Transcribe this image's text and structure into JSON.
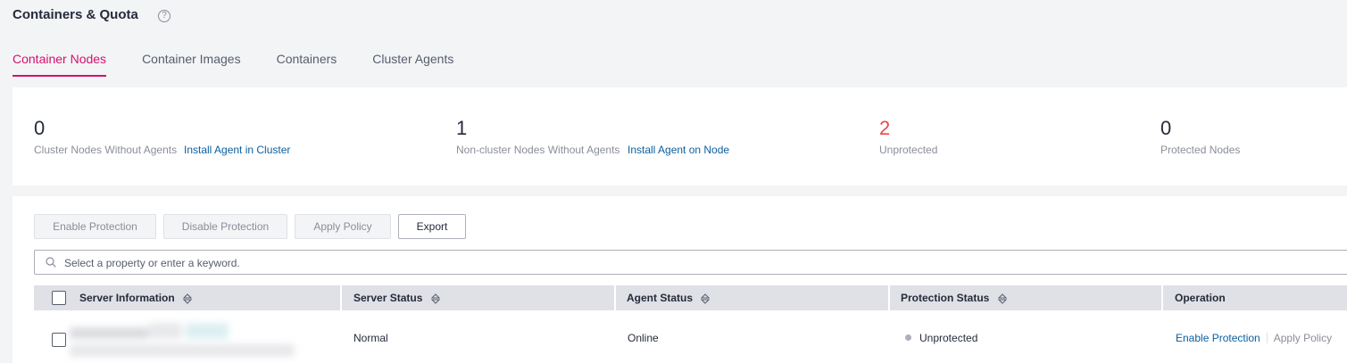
{
  "page": {
    "title": "Containers & Quota",
    "help_icon": "help-icon",
    "help_glyph": "?"
  },
  "tabs": [
    {
      "label": "Container Nodes",
      "active": true
    },
    {
      "label": "Container Images",
      "active": false
    },
    {
      "label": "Containers",
      "active": false
    },
    {
      "label": "Cluster Agents",
      "active": false
    }
  ],
  "stats": [
    {
      "value": "0",
      "label": "Cluster Nodes Without Agents",
      "link": "Install Agent in Cluster"
    },
    {
      "value": "1",
      "label": "Non-cluster Nodes Without Agents",
      "link": "Install Agent on Node"
    },
    {
      "value": "2",
      "label": "Unprotected",
      "color": "#e84a4a"
    },
    {
      "value": "0",
      "label": "Protected Nodes"
    }
  ],
  "toolbar": {
    "enable_protection": "Enable Protection",
    "disable_protection": "Disable Protection",
    "apply_policy": "Apply Policy",
    "export": "Export"
  },
  "search": {
    "placeholder": "Select a property or enter a keyword.",
    "icon": "search-icon"
  },
  "table": {
    "columns": [
      "Server Information",
      "Server Status",
      "Agent Status",
      "Protection Status",
      "Operation"
    ],
    "rows": [
      {
        "server_information": "",
        "server_status": "Normal",
        "agent_status": "Online",
        "protection_status": "Unprotected",
        "operations": [
          "Enable Protection",
          "Apply Policy"
        ]
      }
    ]
  },
  "colors": {
    "accent": "#d3116f",
    "link": "#0a5f9e",
    "unprotected_number": "#e84a4a"
  }
}
